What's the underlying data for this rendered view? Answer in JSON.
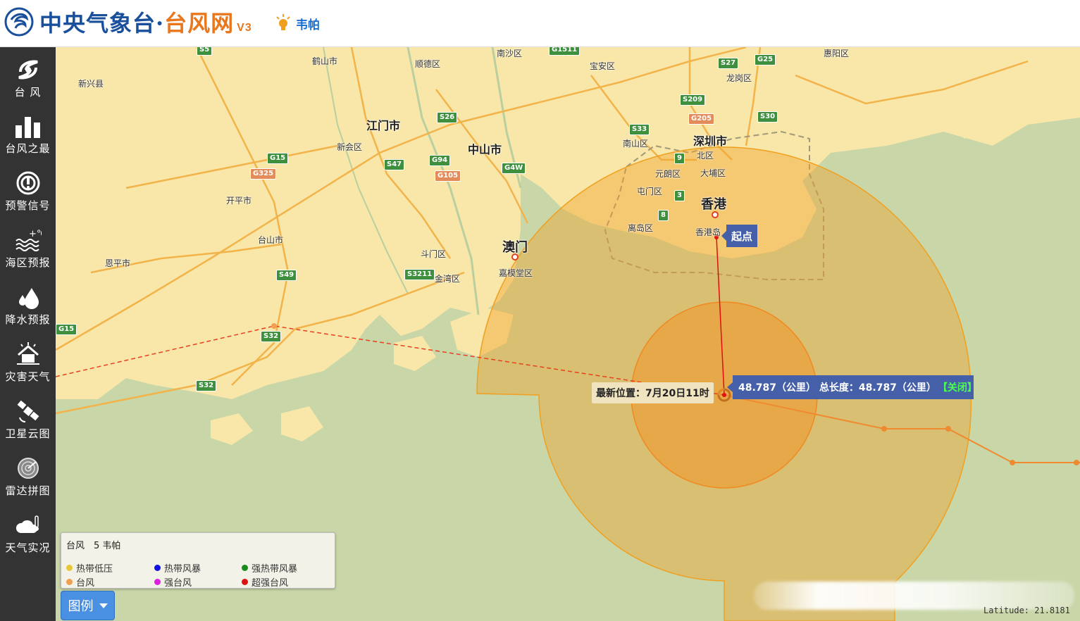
{
  "header": {
    "title_blue": "中央气象台·",
    "title_orange": "台风网",
    "version": "V3",
    "typhoon_name": "韦帕"
  },
  "sidebar": {
    "items": [
      {
        "label": "台 风",
        "icon": "typhoon-icon"
      },
      {
        "label": "台风之最",
        "icon": "bar-chart-icon"
      },
      {
        "label": "预警信号",
        "icon": "alert-signal-icon"
      },
      {
        "label": "海区预报",
        "icon": "sea-temperature-icon"
      },
      {
        "label": "降水预报",
        "icon": "raindrop-icon"
      },
      {
        "label": "灾害天气",
        "icon": "disaster-house-icon"
      },
      {
        "label": "卫星云图",
        "icon": "satellite-icon"
      },
      {
        "label": "雷达拼图",
        "icon": "radar-icon"
      },
      {
        "label": "天气实况",
        "icon": "cloud-thermometer-icon"
      }
    ]
  },
  "map": {
    "place_labels": {
      "xinxing": "新兴县",
      "heshan": "鹤山市",
      "shunde": "顺德区",
      "nansha": "南沙区",
      "baoan": "宝安区",
      "huiyang": "惠阳区",
      "longgang": "龙岗区",
      "jiangmen": "江门市",
      "zhongshan": "中山市",
      "xinhui": "新会区",
      "shenzhen": "深圳市",
      "nanshan": "南山区",
      "beiqu": "北区",
      "yuanlang": "元朗区",
      "dabu": "大埔区",
      "tuenmun": "屯门区",
      "hongkong": "香港",
      "lidao": "离岛区",
      "hkisland": "香港岛",
      "kaiping": "开平市",
      "taishan": "台山市",
      "enping": "恩平市",
      "doumen": "斗门区",
      "jinwan": "金湾区",
      "macau": "澳门",
      "jiamo": "嘉模堂区"
    },
    "highways": [
      "S5",
      "G1511",
      "S27",
      "G25",
      "S209",
      "G205",
      "S33",
      "S30",
      "S26",
      "G15",
      "G325",
      "S47",
      "G94",
      "G105",
      "G4W",
      "S49",
      "S3211",
      "S32",
      "G15",
      "S32",
      "9",
      "3",
      "8"
    ],
    "latest_position": "最新位置：7月20日11时",
    "measure_text": "48.787（公里） 总长度：48.787（公里）",
    "measure_close": "【关闭】",
    "start_label": "起点",
    "latitude_readout": "Latitude: 21.8181"
  },
  "legend": {
    "title": "台风　5 韦帕",
    "items": [
      {
        "label": "热带低压",
        "color": "#e8c838"
      },
      {
        "label": "热带风暴",
        "color": "#1010e0"
      },
      {
        "label": "强热带风暴",
        "color": "#1a8a1a"
      },
      {
        "label": "台风",
        "color": "#f0a050"
      },
      {
        "label": "强台风",
        "color": "#e020e0"
      },
      {
        "label": "超强台风",
        "color": "#e01010"
      }
    ],
    "button_label": "图例"
  },
  "colors": {
    "sidebar_bg": "#333333",
    "land": "#f8e7a8",
    "sea": "#c9d6a8",
    "road": "#f2b34a",
    "wind_circle": "#f0a830",
    "measure_bg": "#4560a8"
  }
}
